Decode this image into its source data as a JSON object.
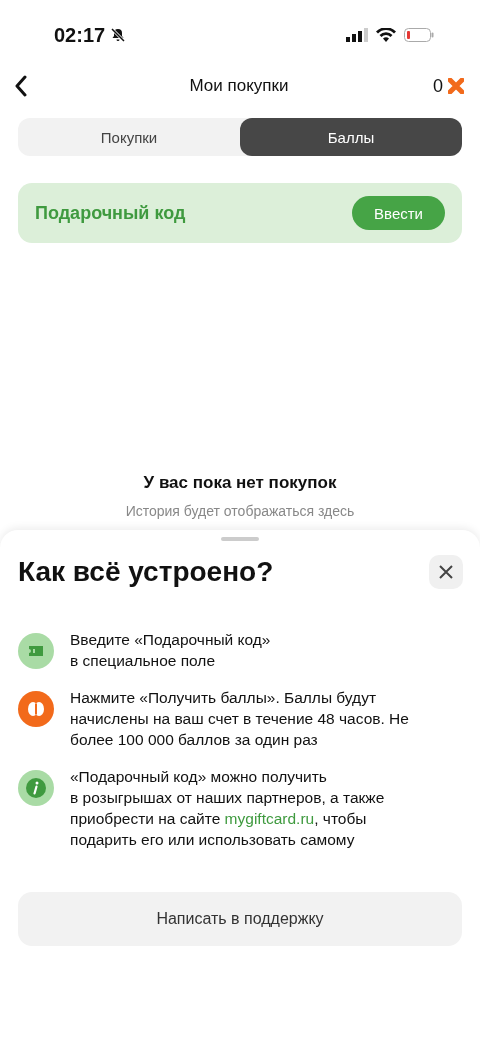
{
  "status_bar": {
    "time": "02:17"
  },
  "header": {
    "title": "Мои покупки",
    "points": "0"
  },
  "tabs": [
    {
      "label": "Покупки",
      "selected": false
    },
    {
      "label": "Баллы",
      "selected": true
    }
  ],
  "gift_code": {
    "label": "Подарочный код",
    "button": "Ввести"
  },
  "empty_state": {
    "title": "У вас пока нет покупок",
    "subtitle": "История будет отображаться здесь"
  },
  "sheet": {
    "title": "Как всё устроено?",
    "steps": [
      {
        "kind": "ticket",
        "text_before": "Введите «Подарочный код»\nв специальное поле"
      },
      {
        "kind": "coin",
        "text_before": "Нажмите «Получить баллы». Баллы будут\nначислены на ваш счет в течение 48 часов. Не\nболее 100 000 баллов за один раз"
      },
      {
        "kind": "info",
        "text_before": "«Подарочный код» можно получить\nв розыгрышах от наших партнеров, а также\nприобрести на сайте ",
        "link": "mygiftcard.ru",
        "text_after": ", чтобы\nподарить его или использовать самому"
      }
    ],
    "support_button": "Написать в поддержку"
  }
}
